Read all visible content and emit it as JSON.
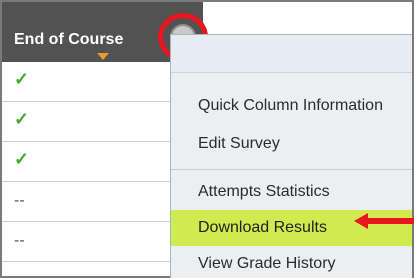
{
  "column_header": {
    "label": "End of Course",
    "menu_button_icon": "chevron-down-icon"
  },
  "rows": [
    {
      "value": "✓"
    },
    {
      "value": "✓"
    },
    {
      "value": "✓"
    },
    {
      "value": "--"
    },
    {
      "value": "--"
    }
  ],
  "menu": {
    "items": [
      {
        "label": "Quick Column Information"
      },
      {
        "label": "Edit Survey"
      },
      {
        "label": "Attempts Statistics"
      },
      {
        "label": "Download Results"
      },
      {
        "label": "View Grade History"
      }
    ]
  },
  "colors": {
    "header_bg": "#525252",
    "highlight": "#d1ea4f",
    "annotation_red": "#e8161f",
    "check_green": "#46a82e"
  }
}
